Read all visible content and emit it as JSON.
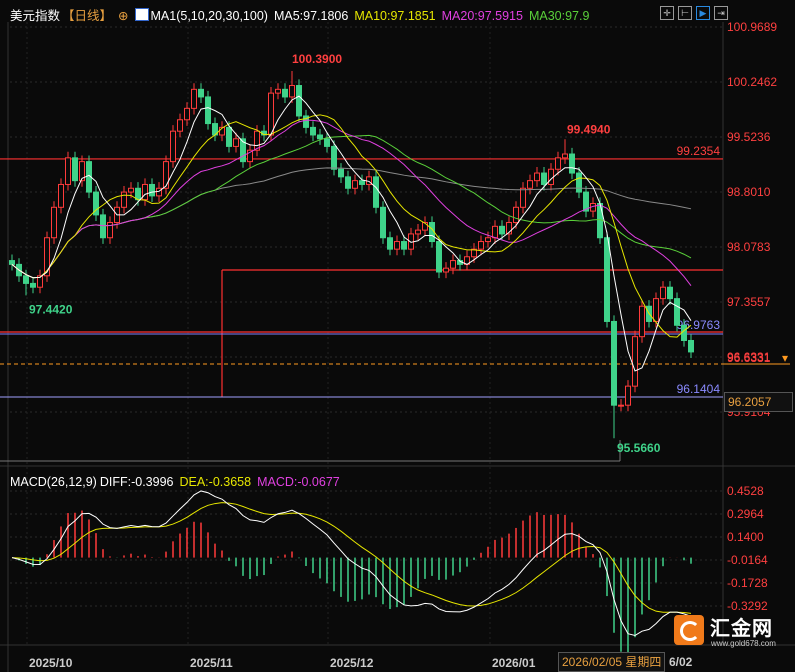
{
  "header": {
    "title": "美元指数",
    "period": "【日线】",
    "indicator": "MA1(5,10,20,30,100)",
    "ma5": "MA5:97.1806",
    "ma10": "MA10:97.1851",
    "ma20": "MA20:97.5915",
    "ma30": "MA30:97.9"
  },
  "macd_header": {
    "name": "MACD(26,12,9)",
    "diff": "DIFF:-0.3996",
    "dea": "DEA:-0.3658",
    "macd": "MACD:-0.0677"
  },
  "toolbar": [
    "crosshair-icon",
    "axis-icon",
    "play-icon",
    "exit-icon"
  ],
  "crosshair": {
    "price": "96.2057",
    "date": "2026/02/05 星期四",
    "date_tail": "6/02"
  },
  "logo": {
    "name": "汇金网",
    "url": "www.gold678.com"
  },
  "colors": {
    "up": "#ff3b3b",
    "down": "#3fd38a",
    "ma5": "#ffffff",
    "ma10": "#e6e600",
    "ma20": "#e040e0",
    "ma30": "#5ad03a",
    "ma100": "#8a8a8a"
  },
  "chart_data": {
    "type": "candlestick",
    "x_labels": [
      "2025/10",
      "2025/11",
      "2025/12",
      "2026/01"
    ],
    "y_ticks": [
      "100.9689",
      "100.2462",
      "99.5236",
      "98.8010",
      "98.0783",
      "97.3557",
      "96.6331",
      "95.9104"
    ],
    "macd_ticks": [
      "0.4528",
      "0.2964",
      "0.1400",
      "-0.0164",
      "-0.1728",
      "-0.3292"
    ],
    "closes": [
      97.85,
      97.7,
      97.6,
      97.55,
      97.7,
      98.2,
      98.6,
      98.9,
      99.25,
      98.95,
      99.2,
      98.8,
      98.5,
      98.2,
      98.4,
      98.6,
      98.8,
      98.85,
      98.7,
      98.9,
      98.75,
      98.85,
      99.2,
      99.6,
      99.75,
      99.9,
      100.15,
      100.05,
      99.7,
      99.55,
      99.65,
      99.4,
      99.5,
      99.2,
      99.35,
      99.6,
      99.55,
      100.1,
      100.15,
      100.05,
      100.2,
      99.8,
      99.65,
      99.55,
      99.5,
      99.4,
      99.1,
      99.0,
      98.85,
      98.95,
      98.9,
      99.0,
      98.6,
      98.2,
      98.05,
      98.15,
      98.05,
      98.25,
      98.3,
      98.4,
      98.15,
      97.75,
      97.8,
      97.9,
      97.85,
      97.95,
      98.05,
      98.15,
      98.2,
      98.35,
      98.25,
      98.4,
      98.6,
      98.85,
      98.95,
      99.05,
      98.9,
      99.1,
      99.25,
      99.3,
      99.05,
      98.8,
      98.55,
      98.65,
      98.2,
      97.1,
      96.0,
      96.0,
      96.25,
      96.9,
      97.3,
      97.1,
      97.4,
      97.55,
      97.4,
      97.05,
      96.85,
      96.7
    ],
    "annotations": [
      {
        "label": "97.4420",
        "value": 97.442,
        "type": "low"
      },
      {
        "label": "100.3900",
        "value": 100.39,
        "type": "high"
      },
      {
        "label": "99.4940",
        "value": 99.494,
        "type": "high"
      },
      {
        "label": "95.5660",
        "value": 95.566,
        "type": "low"
      }
    ],
    "levels": [
      {
        "label": "99.2354",
        "value": 99.2354,
        "color": "#ff3030"
      },
      {
        "label": "96.9763",
        "value": 96.9763,
        "color": "#8080ff"
      },
      {
        "label": "96.1404",
        "value": 96.1404,
        "color": "#8080ff"
      },
      {
        "label": "96.6331",
        "value": 96.6331,
        "color": "#ff9a20"
      }
    ]
  }
}
